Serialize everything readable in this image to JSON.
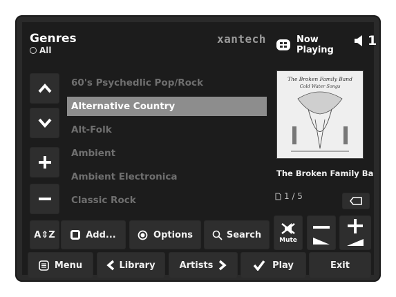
{
  "header": {
    "title": "Genres",
    "filter": "All",
    "brand": "xantech",
    "now_playing_line1": "Now",
    "now_playing_line2": "Playing",
    "zone_number": "1"
  },
  "genres": [
    {
      "label": "60's Psychedlic Pop/Rock",
      "selected": false
    },
    {
      "label": "Alternative Country",
      "selected": true
    },
    {
      "label": "Alt-Folk",
      "selected": false
    },
    {
      "label": "Ambient",
      "selected": false
    },
    {
      "label": "Ambient Electronica",
      "selected": false
    },
    {
      "label": "Classic Rock",
      "selected": false
    }
  ],
  "album": {
    "caption": "The Broken Family Ban",
    "art_text_line1": "The Broken Family Band",
    "art_text_line2": "Cold Water Songs"
  },
  "page_indicator": "1 / 5",
  "toolbar": {
    "sort_label": "A⇕Z",
    "add_label": "Add...",
    "options_label": "Options",
    "search_label": "Search",
    "mute_label": "Mute"
  },
  "bottom": {
    "menu_label": "Menu",
    "library_label": "Library",
    "artists_label": "Artists",
    "play_label": "Play",
    "exit_label": "Exit"
  },
  "colors": {
    "selected_row": "#8d8d8d",
    "panel": "#1c1c1c",
    "button": "#2e2e2e"
  }
}
